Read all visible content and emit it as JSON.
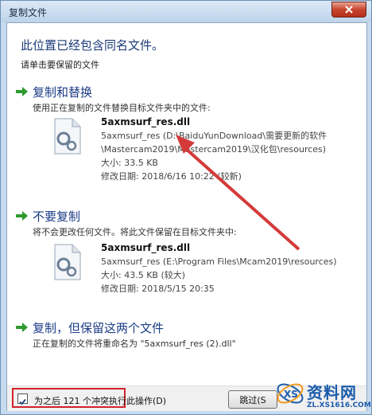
{
  "window": {
    "title": "复制文件",
    "close_icon": "close-icon"
  },
  "dialog": {
    "headline": "此位置已经包含同名文件。",
    "subtext": "请单击要保留的文件"
  },
  "options": [
    {
      "title": "复制和替换",
      "description": "使用正在复制的文件替换目标文件夹中的文件:",
      "file": {
        "name": "5axmsurf_res.dll",
        "path_line1": "5axmsurf_res (D:\\BaiduYunDownload\\需要更新的软件",
        "path_line2": "\\Mastercam2019\\Mastercam2019\\汉化包\\resources)",
        "size": "大小: 33.5 KB",
        "modified": "修改日期: 2018/6/16 10:22 (较新)"
      }
    },
    {
      "title": "不要复制",
      "description": "将不会更改任何文件。将此文件保留在目标文件夹中:",
      "file": {
        "name": "5axmsurf_res.dll",
        "path_line1": "5axmsurf_res (E:\\Program Files\\Mcam2019\\resources)",
        "size": "大小: 43.5 KB (较大)",
        "modified": "修改日期: 2018/5/15 20:35"
      }
    },
    {
      "title": "复制，但保留这两个文件",
      "description": "正在复制的文件将重命名为 \"5axmsurf_res (2).dll\""
    }
  ],
  "footer": {
    "checkbox_label": "为之后 121 个冲突执行此操作(D)",
    "checkbox_checked": true,
    "skip_label": "跳过(S"
  },
  "watermark": {
    "text": "资料网",
    "url": "ZL.XS1616.COM"
  },
  "colors": {
    "accent": "#1c3c86",
    "highlight_red": "#d2232a",
    "arrow_green": "#2e9b2e"
  }
}
